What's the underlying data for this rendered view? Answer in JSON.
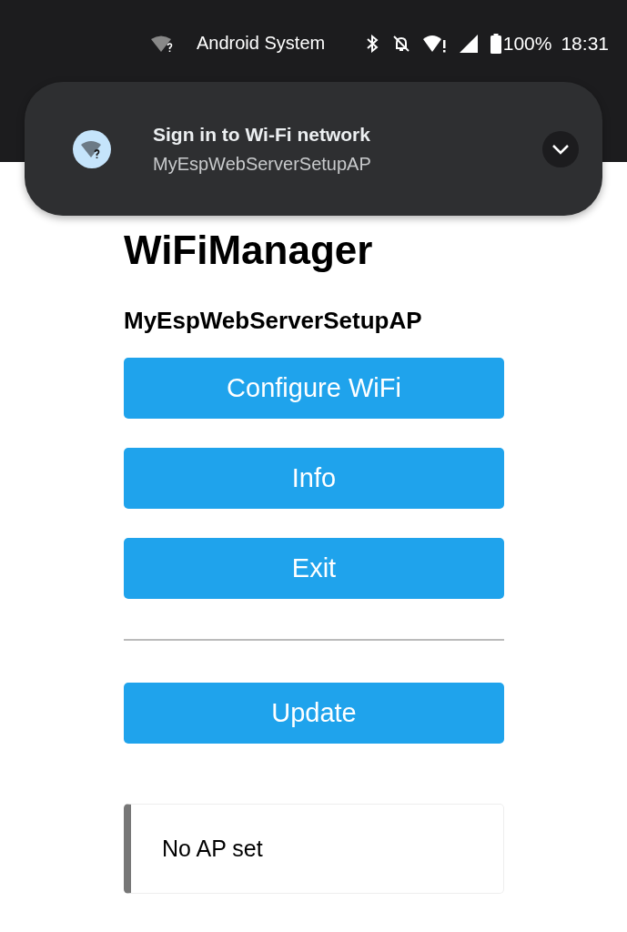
{
  "status_bar": {
    "notifier": "Android System",
    "battery": "100%",
    "time": "18:31"
  },
  "notification": {
    "title": "Sign in to Wi-Fi network",
    "network": "MyEspWebServerSetupAP"
  },
  "page": {
    "title": "WiFiManager",
    "ssid": "MyEspWebServerSetupAP",
    "menu_buttons": [
      "Configure WiFi",
      "Info",
      "Exit"
    ],
    "update_button": "Update",
    "message": "No AP set"
  }
}
